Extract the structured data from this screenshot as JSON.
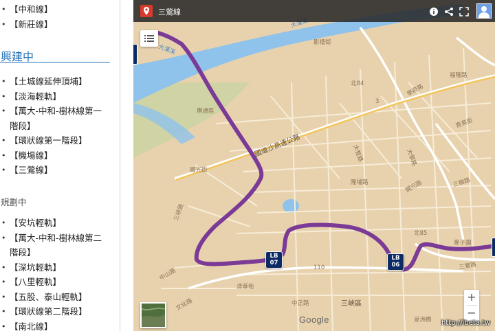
{
  "article": {
    "top_list": [
      "【中和線】",
      "【新莊線】"
    ],
    "section_construction": {
      "title": "興建中",
      "items": [
        "【土城線延伸頂埔】",
        "【淡海輕軌】",
        "【萬大-中和-樹林線第一階段】",
        "【環狀線第一階段】",
        "【機場線】",
        "【三鶯線】"
      ]
    },
    "section_planning": {
      "title": "規劃中",
      "items": [
        "【安坑輕軌】",
        "【萬大-中和-樹林線第二階段】",
        "【深坑輕軌】",
        "【八里輕軌】",
        "【五股、泰山輕軌】",
        "【環狀線第二階段】",
        "【南北線】"
      ]
    }
  },
  "map": {
    "title": "三鶯線",
    "icons": {
      "pin": "map-pin-icon",
      "info": "info-icon",
      "share": "share-icon",
      "fullscreen": "fullscreen-icon",
      "layers": "list-icon",
      "account": "account-avatar-icon"
    },
    "route_color": "#7b3a96",
    "station_color": "#0c2a63",
    "stations": [
      {
        "code": "LB",
        "num": "07"
      },
      {
        "code": "LB",
        "num": "06"
      }
    ],
    "labels": {
      "river_top": "大漢溪",
      "river_left": "大漢溪",
      "road_expressway": "國道沙高速公路",
      "district": "三峽區",
      "area_fuxing": "福隆路",
      "area_haiyun": "影禧街",
      "area_nantong": "南通區",
      "area_wenhua": "文化路",
      "area_zhongshan": "中山路",
      "area_sanshu": "三樹路",
      "area_xuecheng": "學府路",
      "road_sign_1": "北84",
      "road_sign_2": "北85",
      "road_sign_3": "110",
      "road_sign_4": "3",
      "area_jiahe": "麥子園",
      "area_sanying": "三鶯路",
      "area_guoguang": "國光街",
      "area_longpu": "隆埔路",
      "area_daxue": "大學路",
      "area_sanjiao": "三峽路",
      "area_zhongzheng": "中正路",
      "area_quanren": "泉洲橋",
      "area_baitou": "大智路",
      "area_kaiyuan": "開元路",
      "area_qinghua": "清華街",
      "area_yuhuang": "育英街"
    },
    "zoom_in": "+",
    "zoom_out": "−",
    "google_logo": "Google",
    "watermark": "http://ibeta.tw"
  }
}
